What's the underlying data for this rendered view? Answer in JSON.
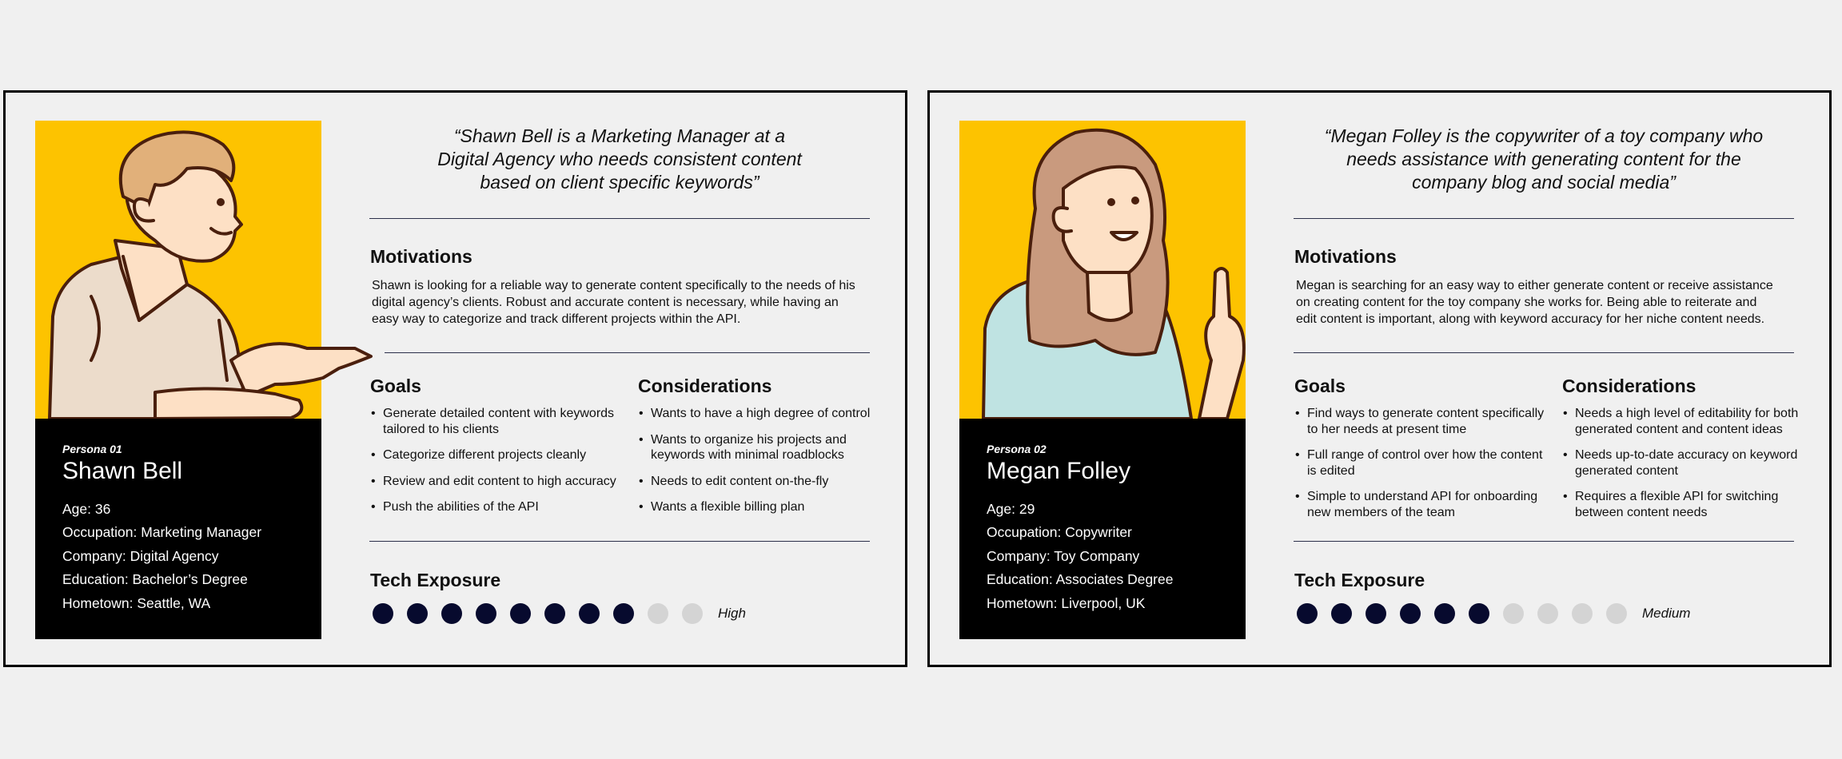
{
  "personas": [
    {
      "tag": "Persona 01",
      "name": "Shawn Bell",
      "details": [
        "Age: 36",
        "Occupation: Marketing Manager",
        "Company: Digital Agency",
        "Education: Bachelor’s Degree",
        "Hometown: Seattle, WA"
      ],
      "quote_lines": [
        "“Shawn Bell is a Marketing Manager at a",
        "Digital Agency who needs consistent content",
        "based on client specific keywords”"
      ],
      "motivations_heading": "Motivations",
      "motivation_lines": [
        "Shawn is looking for a reliable way to generate content specifically to the needs of his",
        "digital agency’s clients. Robust and accurate content is necessary, while having an",
        "easy way to categorize and track different projects within the API."
      ],
      "goals_heading": "Goals",
      "goals": [
        [
          "Generate detailed content with keywords",
          "tailored to his clients"
        ],
        [
          "Categorize different projects cleanly"
        ],
        [
          "Review and edit content to high accuracy"
        ],
        [
          "Push the abilities of the API"
        ]
      ],
      "considerations_heading": "Considerations",
      "considerations": [
        [
          "Wants to have a high degree of control"
        ],
        [
          "Wants to organize his projects and",
          "keywords with minimal roadblocks"
        ],
        [
          "Needs to edit content on-the-fly"
        ],
        [
          "Wants a flexible billing plan"
        ]
      ],
      "tech_heading": "Tech Exposure",
      "tech_level_value": 8,
      "tech_level_max": 10,
      "tech_level_label": "High",
      "illustration": "man-gesturing-illustration",
      "shirt_color": "#ecdccb"
    },
    {
      "tag": "Persona 02",
      "name": "Megan Folley",
      "details": [
        "Age: 29",
        "Occupation: Copywriter",
        "Company: Toy Company",
        "Education: Associates Degree",
        "Hometown: Liverpool, UK"
      ],
      "quote_lines": [
        "“Megan Folley is the copywriter of a toy company who",
        "needs assistance with generating content for the",
        "company blog and social media”"
      ],
      "motivations_heading": "Motivations",
      "motivation_lines": [
        "Megan is searching for an easy way to either generate content or receive assistance",
        "on creating content for the toy company she works for. Being able to reiterate and",
        "edit content is important, along with keyword accuracy for her niche content needs."
      ],
      "goals_heading": "Goals",
      "goals": [
        [
          "Find ways to generate content specifically",
          "to her needs at present time"
        ],
        [
          "Full range of control over how the content",
          "is edited"
        ],
        [
          "Simple to understand API for onboarding",
          "new members of the team"
        ]
      ],
      "considerations_heading": "Considerations",
      "considerations": [
        [
          "Needs a high level of editability for both",
          "generated content and content ideas"
        ],
        [
          "Needs up-to-date accuracy on keyword",
          "generated content"
        ],
        [
          "Requires a flexible API for switching",
          "between content needs"
        ]
      ],
      "tech_heading": "Tech Exposure",
      "tech_level_value": 6,
      "tech_level_max": 10,
      "tech_level_label": "Medium",
      "illustration": "woman-pointing-up-illustration",
      "shirt_color": "#bfe3e2"
    }
  ],
  "colors": {
    "photo_background": "#fdc300",
    "info_background": "#000000",
    "dot_filled": "#070a2e",
    "dot_empty": "#d4d4d4",
    "divider": "#2b2f4a"
  }
}
